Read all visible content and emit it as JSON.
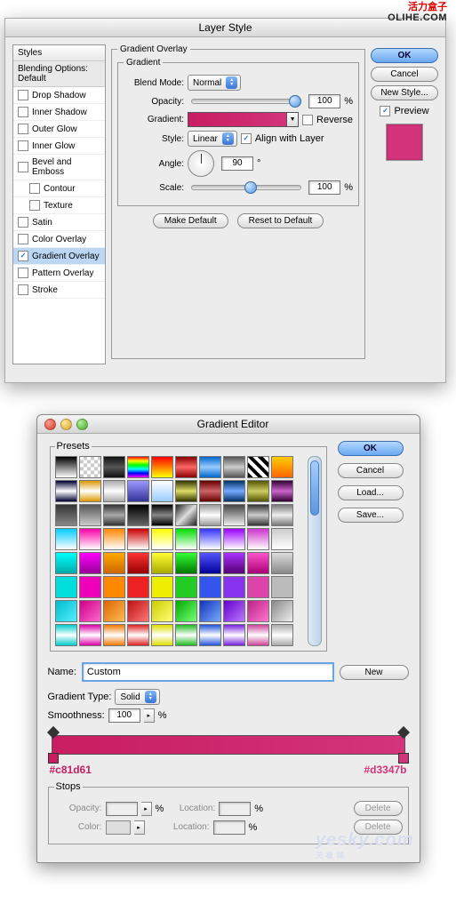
{
  "watermark": {
    "line1": "活力盒子",
    "line2": "OLIHE.COM"
  },
  "layerStyle": {
    "title": "Layer Style",
    "stylesHeader": "Styles",
    "blendingDefault": "Blending Options: Default",
    "effects": [
      {
        "label": "Drop Shadow",
        "checked": false,
        "indent": false,
        "selected": false
      },
      {
        "label": "Inner Shadow",
        "checked": false,
        "indent": false,
        "selected": false
      },
      {
        "label": "Outer Glow",
        "checked": false,
        "indent": false,
        "selected": false
      },
      {
        "label": "Inner Glow",
        "checked": false,
        "indent": false,
        "selected": false
      },
      {
        "label": "Bevel and Emboss",
        "checked": false,
        "indent": false,
        "selected": false
      },
      {
        "label": "Contour",
        "checked": false,
        "indent": true,
        "selected": false
      },
      {
        "label": "Texture",
        "checked": false,
        "indent": true,
        "selected": false
      },
      {
        "label": "Satin",
        "checked": false,
        "indent": false,
        "selected": false
      },
      {
        "label": "Color Overlay",
        "checked": false,
        "indent": false,
        "selected": false
      },
      {
        "label": "Gradient Overlay",
        "checked": true,
        "indent": false,
        "selected": true
      },
      {
        "label": "Pattern Overlay",
        "checked": false,
        "indent": false,
        "selected": false
      },
      {
        "label": "Stroke",
        "checked": false,
        "indent": false,
        "selected": false
      }
    ],
    "panelTitle": "Gradient Overlay",
    "gradientGroup": "Gradient",
    "blendModeLabel": "Blend Mode:",
    "blendModeValue": "Normal",
    "opacityLabel": "Opacity:",
    "opacityValue": "100",
    "opacityUnit": "%",
    "gradientLabel": "Gradient:",
    "reverseLabel": "Reverse",
    "styleLabel": "Style:",
    "styleValue": "Linear",
    "alignLabel": "Align with Layer",
    "angleLabel": "Angle:",
    "angleValue": "90",
    "angleUnit": "°",
    "scaleLabel": "Scale:",
    "scaleValue": "100",
    "scaleUnit": "%",
    "makeDefault": "Make Default",
    "resetDefault": "Reset to Default",
    "buttons": {
      "ok": "OK",
      "cancel": "Cancel",
      "newStyle": "New Style...",
      "previewLabel": "Preview"
    },
    "previewColor": "#d3347b"
  },
  "gradientEditor": {
    "title": "Gradient Editor",
    "presetsLabel": "Presets",
    "buttons": {
      "ok": "OK",
      "cancel": "Cancel",
      "load": "Load...",
      "save": "Save...",
      "new": "New",
      "delete": "Delete"
    },
    "nameLabel": "Name:",
    "nameValue": "Custom",
    "gradientTypeLabel": "Gradient Type:",
    "gradientTypeValue": "Solid",
    "smoothnessLabel": "Smoothness:",
    "smoothnessValue": "100",
    "smoothnessUnit": "%",
    "leftStopHex": "#c81d61",
    "rightStopHex": "#d3347b",
    "stopsLabel": "Stops",
    "opacityLabel": "Opacity:",
    "opacityUnit": "%",
    "locationLabel": "Location:",
    "locationUnit": "%",
    "colorLabel": "Color:",
    "presets": [
      "linear-gradient(#000,#fff)",
      "repeating-conic-gradient(#ccc 0 25%,#fff 0 50%) 0/8px 8px",
      "linear-gradient(#111,#555,#111)",
      "linear-gradient(#f00,#ff0,#0f0,#0ff,#00f,#f0f)",
      "linear-gradient(#f00,#ff0)",
      "linear-gradient(#800,#f66,#800)",
      "linear-gradient(#06c,#9cf,#06c)",
      "linear-gradient(#555,#ccc,#555)",
      "repeating-linear-gradient(45deg,#000 0 4px,#fff 4px 8px)",
      "linear-gradient(#fc0,#f60)",
      "linear-gradient(#003,#fff,#003)",
      "linear-gradient(#d90,#fff,#d90)",
      "linear-gradient(#aaa,#fff,#aaa)",
      "linear-gradient(#99f,#339)",
      "linear-gradient(#fff,#9cf)",
      "linear-gradient(#330,#dd6,#330)",
      "linear-gradient(#600,#c66,#600)",
      "linear-gradient(#036,#7af,#036)",
      "linear-gradient(#550,#cc6,#550)",
      "linear-gradient(#303,#c6c,#303)",
      "linear-gradient(#333,#888)",
      "linear-gradient(#555,#ccc)",
      "linear-gradient(#333,#aaa,#333)",
      "linear-gradient(#000,#666)",
      "linear-gradient(#000,#888,#000)",
      "linear-gradient(135deg,#222,#ddd,#222)",
      "linear-gradient(#999,#fff,#999)",
      "linear-gradient(#444,#eee)",
      "linear-gradient(#333,#ccc,#333)",
      "linear-gradient(#777,#eee,#777)",
      "linear-gradient(#0cf,#fff)",
      "linear-gradient(#f0a,#fff)",
      "linear-gradient(#f80,#fff)",
      "linear-gradient(#c00,#fff)",
      "linear-gradient(#ff0,#fff)",
      "linear-gradient(#0d0,#fff)",
      "linear-gradient(#33f,#fff)",
      "linear-gradient(#90f,#fff)",
      "linear-gradient(#c3c,#fff)",
      "linear-gradient(#ccc,#fff)",
      "linear-gradient(#0ff,#0aa)",
      "linear-gradient(#f0f,#909)",
      "linear-gradient(#fa0,#c60)",
      "linear-gradient(#f33,#900)",
      "linear-gradient(#ff3,#aa0)",
      "linear-gradient(#3f3,#070)",
      "linear-gradient(#55f,#009)",
      "linear-gradient(#a3f,#507)",
      "linear-gradient(#f5c,#a07)",
      "linear-gradient(#ddd,#888)",
      "#0dd",
      "#e0b",
      "#f80",
      "#e22",
      "#ee0",
      "#2c2",
      "#35e",
      "#83e",
      "#d4a",
      "#bbb",
      "linear-gradient(135deg,#0bc,#5ef)",
      "linear-gradient(135deg,#c08,#f6c)",
      "linear-gradient(135deg,#d60,#fb5)",
      "linear-gradient(135deg,#b11,#f77)",
      "linear-gradient(135deg,#cc0,#ff7)",
      "linear-gradient(135deg,#0a0,#7f7)",
      "linear-gradient(135deg,#13b,#7af)",
      "linear-gradient(135deg,#60c,#b7f)",
      "linear-gradient(135deg,#b28,#f7c)",
      "linear-gradient(135deg,#888,#eee)",
      "linear-gradient(#0cc,#fff,#0cc)",
      "linear-gradient(#d0a,#fff,#d0a)",
      "linear-gradient(#e70,#fff,#e70)",
      "linear-gradient(#d22,#fff,#d22)",
      "linear-gradient(#dd0,#fff,#dd0)",
      "linear-gradient(#2b2,#fff,#2b2)",
      "linear-gradient(#25d,#fff,#25d)",
      "linear-gradient(#72d,#fff,#72d)",
      "linear-gradient(#c49,#fff,#c49)",
      "linear-gradient(#aaa,#fff,#aaa)"
    ]
  },
  "bottomWatermark": {
    "main": "yesky",
    "sub": ".com",
    "cn": "天极网"
  }
}
